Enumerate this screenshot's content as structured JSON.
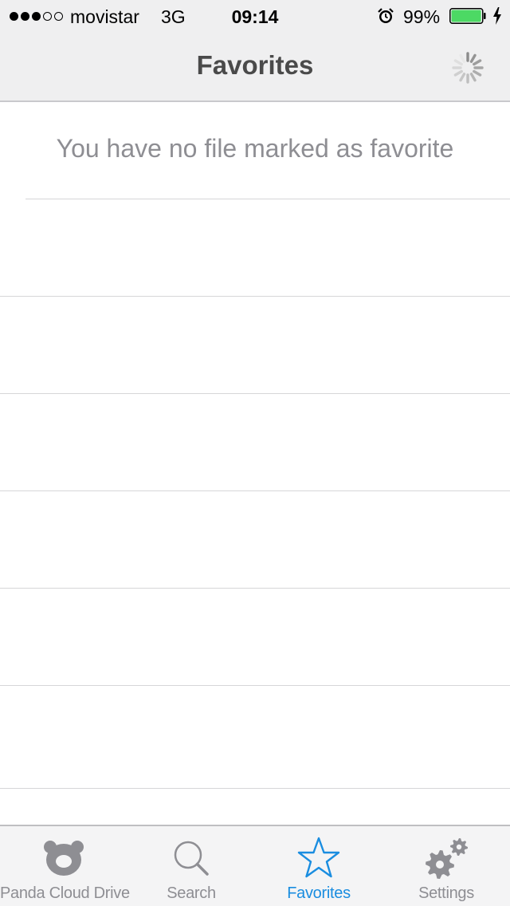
{
  "status_bar": {
    "carrier": "movistar",
    "network": "3G",
    "time": "09:14",
    "battery_percent": "99%",
    "signal_bars_filled": 3,
    "signal_bars_total": 5,
    "battery_level": 0.99,
    "battery_color": "#4cd964",
    "icons": [
      "alarm-icon",
      "battery-icon",
      "charging-bolt-icon"
    ]
  },
  "nav_bar": {
    "title": "Favorites",
    "right_icon": "loading-spinner-icon"
  },
  "main": {
    "empty_message": "You have no file marked as favorite"
  },
  "tab_bar": {
    "active_color": "#1a8de0",
    "inactive_color": "#8e8e93",
    "tabs": [
      {
        "label": "Panda Cloud Drive",
        "icon": "panda-icon",
        "active": false
      },
      {
        "label": "Search",
        "icon": "search-icon",
        "active": false
      },
      {
        "label": "Favorites",
        "icon": "star-icon",
        "active": true
      },
      {
        "label": "Settings",
        "icon": "gears-icon",
        "active": false
      }
    ]
  }
}
